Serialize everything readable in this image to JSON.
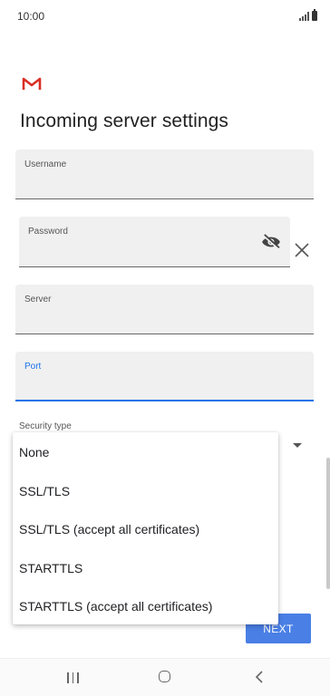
{
  "status_bar": {
    "time": "10:00"
  },
  "page": {
    "title": "Incoming server settings"
  },
  "fields": {
    "username": {
      "label": "Username",
      "value": ""
    },
    "password": {
      "label": "Password",
      "value": ""
    },
    "server": {
      "label": "Server",
      "value": ""
    },
    "port": {
      "label": "Port",
      "value": ""
    }
  },
  "security": {
    "label": "Security type",
    "options": [
      "None",
      "SSL/TLS",
      "SSL/TLS (accept all certificates)",
      "STARTTLS",
      "STARTTLS (accept all certificates)"
    ]
  },
  "buttons": {
    "next": "NEXT"
  },
  "icons": {
    "app_logo": "gmail-icon",
    "password_toggle": "eye-off-icon",
    "clear": "close-icon",
    "nav_recent": "recent-apps-icon",
    "nav_home": "home-icon",
    "nav_back": "back-icon"
  },
  "colors": {
    "accent": "#1a73e8",
    "button": "#4a7fe6",
    "gmail_red": "#d93025"
  }
}
